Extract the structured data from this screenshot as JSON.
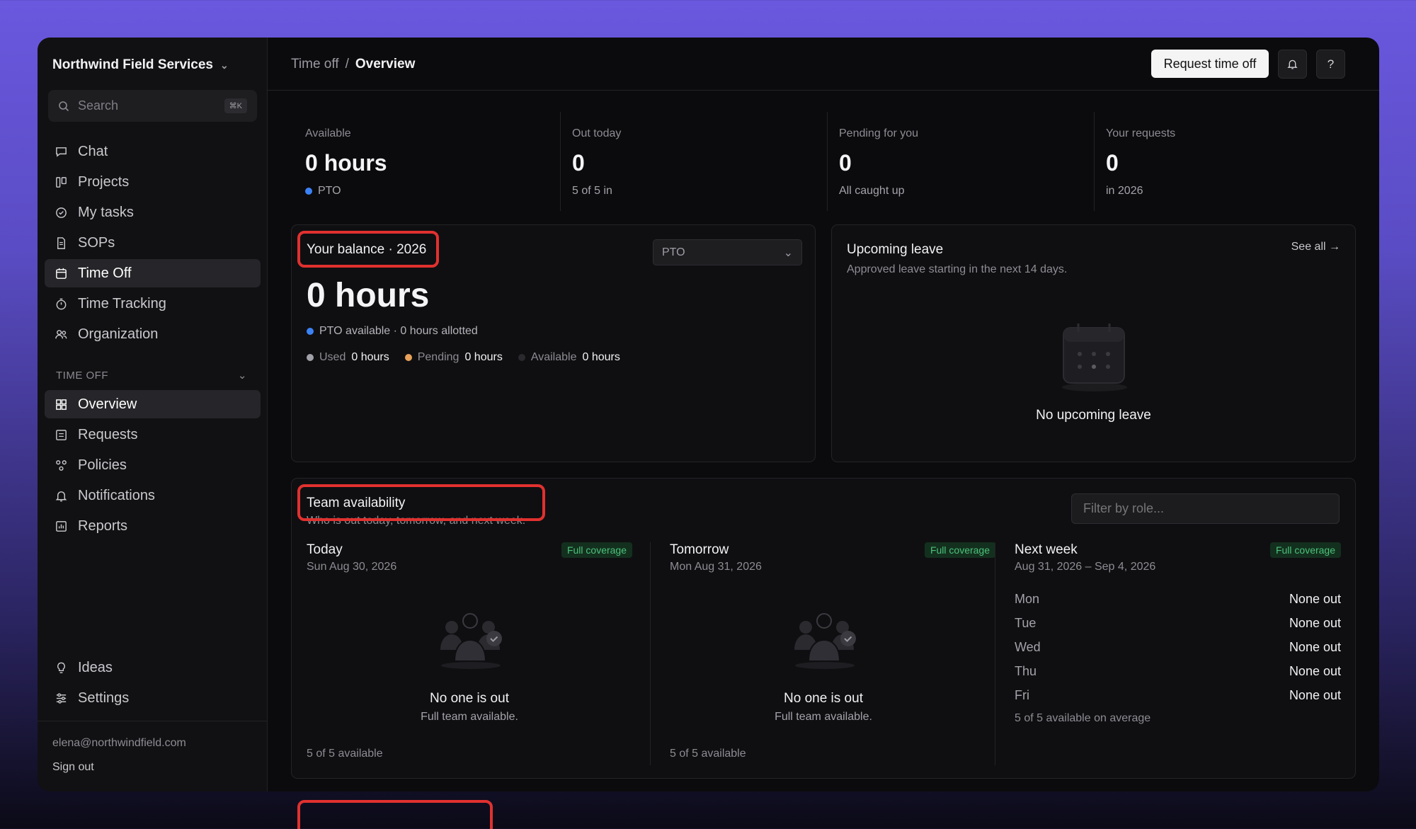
{
  "org": {
    "name": "Northwind Field Services"
  },
  "search": {
    "placeholder": "Search",
    "shortcut": "⌘K"
  },
  "nav": [
    {
      "label": "Chat",
      "icon": "chat-icon"
    },
    {
      "label": "Projects",
      "icon": "projects-icon"
    },
    {
      "label": "My tasks",
      "icon": "tasks-icon"
    },
    {
      "label": "SOPs",
      "icon": "document-icon"
    },
    {
      "label": "Time Off",
      "icon": "calendar-icon",
      "active": true
    },
    {
      "label": "Time Tracking",
      "icon": "stopwatch-icon"
    },
    {
      "label": "Organization",
      "icon": "people-icon"
    }
  ],
  "section": {
    "label": "TIME OFF"
  },
  "subnav": [
    {
      "label": "Overview",
      "icon": "grid-icon",
      "active": true
    },
    {
      "label": "Requests",
      "icon": "list-icon"
    },
    {
      "label": "Policies",
      "icon": "policies-icon"
    },
    {
      "label": "Notifications",
      "icon": "bell-icon"
    },
    {
      "label": "Reports",
      "icon": "chart-icon"
    }
  ],
  "bottom_nav": [
    {
      "label": "Ideas",
      "icon": "lightbulb-icon"
    },
    {
      "label": "Settings",
      "icon": "sliders-icon"
    }
  ],
  "account": {
    "email": "elena@northwindfield.com",
    "sign_out": "Sign out"
  },
  "breadcrumb": {
    "parent": "Time off",
    "separator": "/",
    "current": "Overview"
  },
  "header": {
    "request_button": "Request time off",
    "help": "?"
  },
  "stats": [
    {
      "label": "Available",
      "value": "0 hours",
      "sub": "PTO"
    },
    {
      "label": "Out today",
      "value": "0",
      "sub": "5 of 5 in"
    },
    {
      "label": "Pending for you",
      "value": "0",
      "sub": "All caught up"
    },
    {
      "label": "Your requests",
      "value": "0",
      "sub": "in 2026"
    }
  ],
  "balance": {
    "title": "Your balance · 2026",
    "select_value": "PTO",
    "hours": "0 hours",
    "summary": "PTO available · 0 hours allotted",
    "used_label": "Used",
    "used_value": "0 hours",
    "pending_label": "Pending",
    "pending_value": "0 hours",
    "available_label": "Available",
    "available_value": "0 hours"
  },
  "upcoming": {
    "title": "Upcoming leave",
    "subtitle": "Approved leave starting in the next 14 days.",
    "see_all": "See all →",
    "empty": "No upcoming leave"
  },
  "team": {
    "title": "Team availability",
    "subtitle": "Who is out today, tomorrow, and next week.",
    "filter_placeholder": "Filter by role...",
    "today": {
      "title": "Today",
      "date": "Sun Aug 30, 2026",
      "badge": "Full coverage",
      "empty_title": "No one is out",
      "empty_sub": "Full team available.",
      "footer": "5 of 5 available"
    },
    "tomorrow": {
      "title": "Tomorrow",
      "date": "Mon Aug 31, 2026",
      "badge": "Full coverage",
      "empty_title": "No one is out",
      "empty_sub": "Full team available.",
      "footer": "5 of 5 available"
    },
    "next_week": {
      "title": "Next week",
      "date": "Aug 31, 2026 – Sep 4, 2026",
      "badge": "Full coverage",
      "days": [
        {
          "day": "Mon",
          "status": "None out"
        },
        {
          "day": "Tue",
          "status": "None out"
        },
        {
          "day": "Wed",
          "status": "None out"
        },
        {
          "day": "Thu",
          "status": "None out"
        },
        {
          "day": "Fri",
          "status": "None out"
        }
      ],
      "footer": "5 of 5 available on average"
    }
  },
  "colors": {
    "accent_blue": "#3b82f6",
    "pending_orange": "#e8a15a",
    "used_gray": "#a1a1aa",
    "coverage_green": "#4cc27a",
    "highlight_red": "#e0312f"
  }
}
